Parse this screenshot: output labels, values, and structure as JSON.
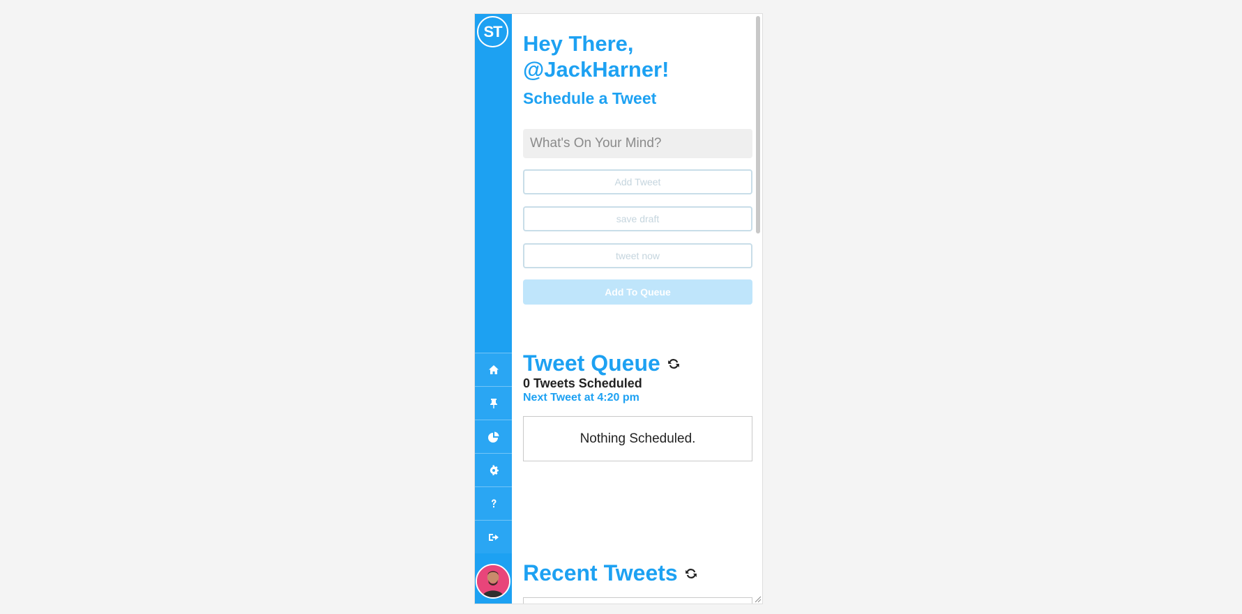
{
  "sidebar": {
    "logo_text": "ST",
    "nav": [
      {
        "name": "home-icon"
      },
      {
        "name": "pin-icon"
      },
      {
        "name": "pie-chart-icon"
      },
      {
        "name": "gear-icon"
      },
      {
        "name": "question-icon"
      },
      {
        "name": "sign-out-icon"
      }
    ],
    "accent": "#1da1f2"
  },
  "header": {
    "greeting_line1": "Hey There,",
    "greeting_line2": "@JackHarner!",
    "subtitle": "Schedule a Tweet"
  },
  "composer": {
    "placeholder": "What's On Your Mind?",
    "add_tweet": "Add Tweet",
    "save_draft": "save draft",
    "tweet_now": "tweet now",
    "add_to_queue": "Add To Queue"
  },
  "queue": {
    "title": "Tweet Queue",
    "count_text": "0 Tweets Scheduled",
    "next_text": "Next Tweet at 4:20 pm",
    "empty_text": "Nothing Scheduled."
  },
  "recent": {
    "title": "Recent Tweets"
  }
}
